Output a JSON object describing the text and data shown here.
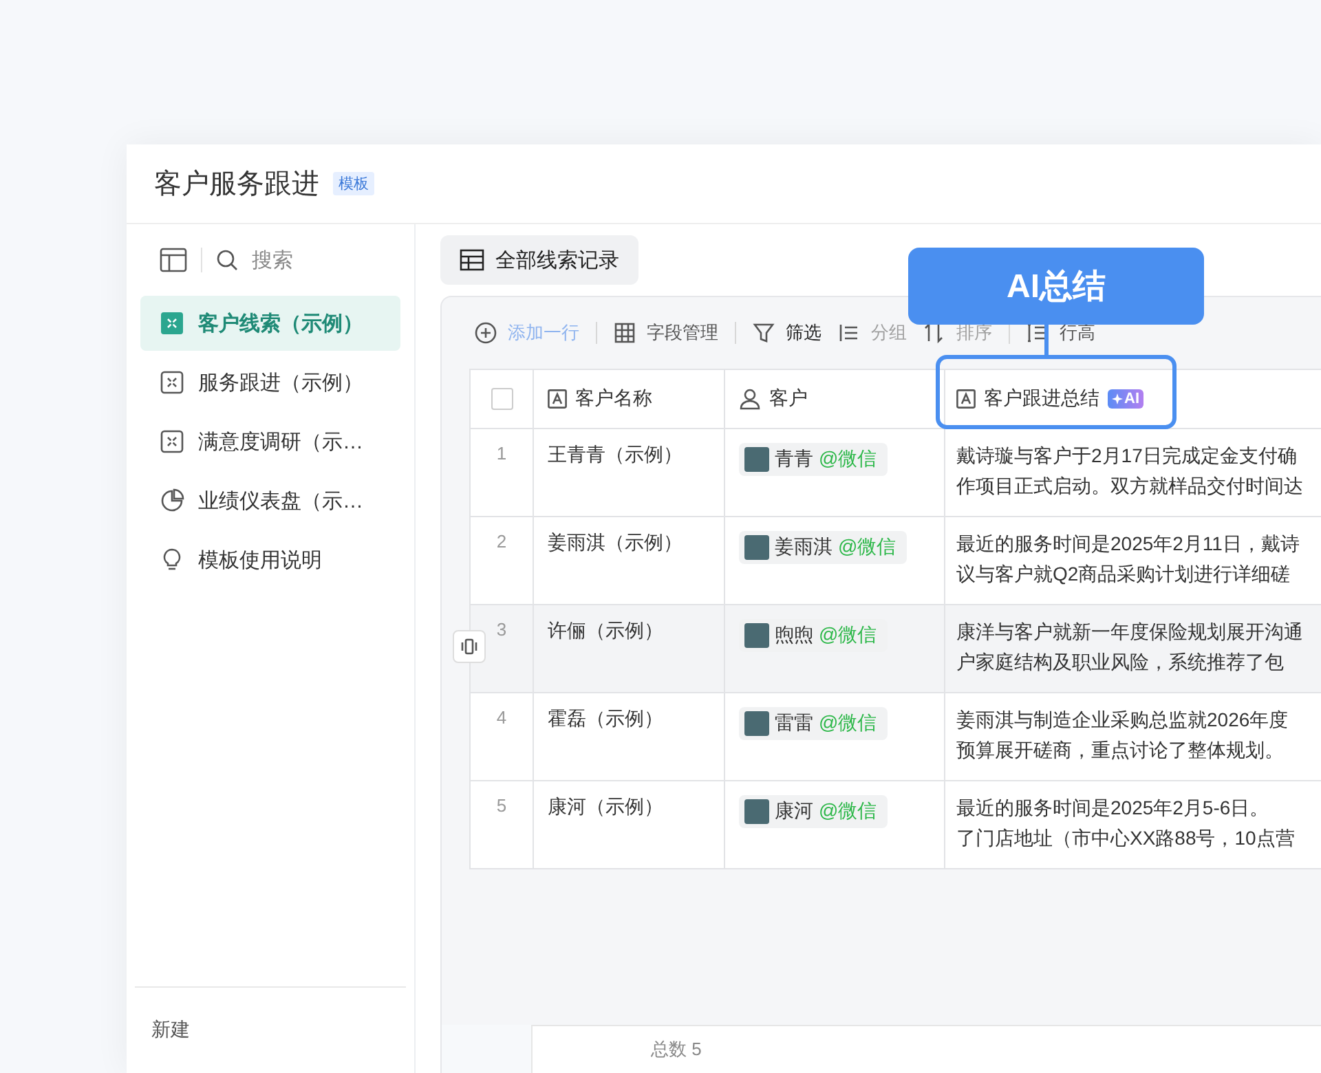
{
  "app": {
    "title": "客户服务跟进",
    "badge": "模板"
  },
  "sidebar": {
    "search": {
      "placeholder": "搜索"
    },
    "items": [
      {
        "label": "客户线索（示例）",
        "kind": "table",
        "selected": true
      },
      {
        "label": "服务跟进（示例）",
        "kind": "table",
        "selected": false
      },
      {
        "label": "满意度调研（示…",
        "kind": "table",
        "selected": false
      },
      {
        "label": "业绩仪表盘（示…",
        "kind": "dashboard",
        "selected": false
      },
      {
        "label": "模板使用说明",
        "kind": "doc",
        "selected": false
      }
    ],
    "new_button": "新建"
  },
  "view_tab": {
    "label": "全部线索记录"
  },
  "toolbar": [
    {
      "label": "添加一行",
      "kind": "add",
      "disabled": false
    },
    {
      "label": "字段管理",
      "kind": "fields",
      "disabled": false
    },
    {
      "label": "筛选",
      "kind": "filter",
      "disabled": false
    },
    {
      "label": "分组",
      "kind": "group",
      "disabled": true
    },
    {
      "label": "排序",
      "kind": "sort",
      "disabled": true
    },
    {
      "label": "行高",
      "kind": "height",
      "disabled": false
    }
  ],
  "table": {
    "select_all": {
      "checked": false
    },
    "columns": [
      {
        "label": "客户名称",
        "kind": "text"
      },
      {
        "label": "客户",
        "kind": "person"
      },
      {
        "label": "客户跟进总结",
        "kind": "text",
        "ai_badge": "AI"
      }
    ],
    "rows": [
      {
        "number": "1",
        "name": "王青青（示例）",
        "customer": {
          "name": "青青",
          "source": "@微信"
        },
        "summary": [
          "戴诗璇与客户于2月17日完成定金支付确",
          "作项目正式启动。双方就样品交付时间达"
        ],
        "highlighted": false
      },
      {
        "number": "2",
        "name": "姜雨淇（示例）",
        "customer": {
          "name": "姜雨淇",
          "source": "@微信"
        },
        "summary": [
          "最近的服务时间是2025年2月11日，戴诗",
          "议与客户就Q2商品采购计划进行详细磋"
        ],
        "highlighted": false
      },
      {
        "number": "3",
        "name": "许俪（示例）",
        "customer": {
          "name": "煦煦",
          "source": "@微信"
        },
        "summary": [
          "康洋与客户就新一年度保险规划展开沟通",
          "户家庭结构及职业风险，系统推荐了包"
        ],
        "highlighted": true
      },
      {
        "number": "4",
        "name": "霍磊（示例）",
        "customer": {
          "name": "雷雷",
          "source": "@微信"
        },
        "summary": [
          "姜雨淇与制造企业采购总监就2026年度",
          "预算展开磋商，重点讨论了整体规划。"
        ],
        "highlighted": false
      },
      {
        "number": "5",
        "name": "康河（示例）",
        "customer": {
          "name": "康河",
          "source": "@微信"
        },
        "summary": [
          "最近的服务时间是2025年2月5-6日。",
          "了门店地址（市中心XX路88号，10点营"
        ],
        "highlighted": false
      }
    ],
    "footer": "总数 5"
  },
  "callout": {
    "label": "AI总结"
  }
}
